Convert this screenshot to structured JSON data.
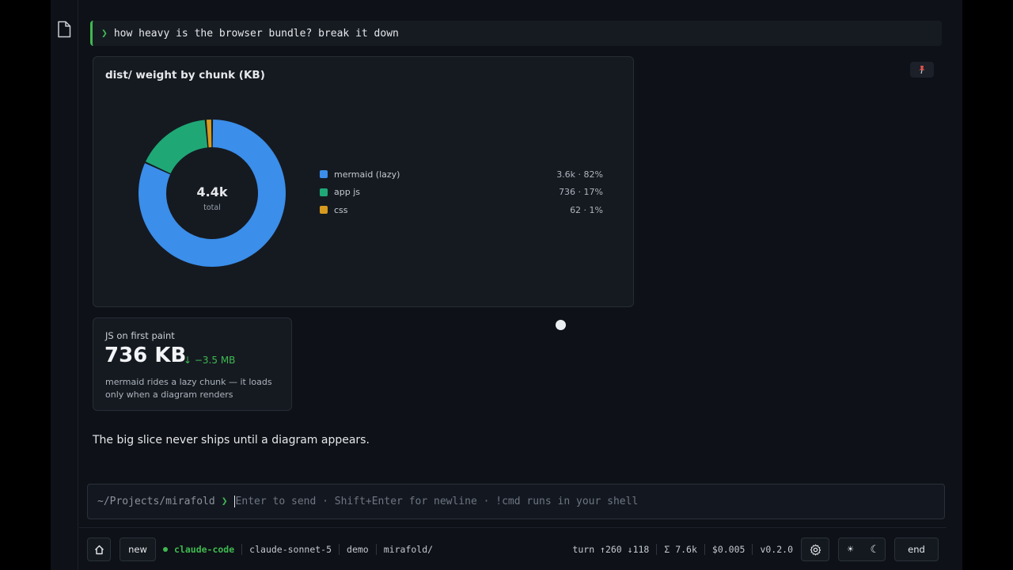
{
  "prompt": {
    "chevron": "❯",
    "text": "how heavy is the browser bundle? break it down"
  },
  "chart_data": {
    "type": "pie",
    "title": "dist/ weight by chunk (KB)",
    "center_value": "4.4k",
    "center_label": "total",
    "categories": [
      "mermaid (lazy)",
      "app js",
      "css"
    ],
    "values": [
      3600,
      736,
      62
    ],
    "value_labels": [
      "3.6k · 82%",
      "736 · 17%",
      "62 · 1%"
    ],
    "colors": [
      "#3b8eea",
      "#1fa876",
      "#d69a1e"
    ],
    "legend": "right"
  },
  "stat": {
    "label": "JS on first paint",
    "value": "736 KB",
    "delta": "↓ −3.5 MB",
    "note": "mermaid rides a lazy chunk — it loads only when a diagram renders",
    "delta_color": "#3fb950"
  },
  "answer": "The big slice never ships until a diagram appears.",
  "input": {
    "path": "~/Projects/mirafold",
    "chevron": "❯",
    "placeholder": "Enter to send · Shift+Enter for newline · !cmd runs in your shell"
  },
  "status": {
    "new_label": "new",
    "agent": "claude-code",
    "model": "claude-sonnet-5",
    "mode": "demo",
    "folder": "mirafold/",
    "turn": "turn ↑260 ↓118",
    "total": "Σ 7.6k",
    "cost": "$0.005",
    "version": "v0.2.0",
    "end_label": "end"
  },
  "icons": {
    "rail": "file-icon",
    "pin": "pin-icon",
    "home": "home-icon",
    "gear": "gear-icon",
    "light": "sun-icon",
    "dark": "moon-icon"
  },
  "colors": {
    "accent": "#3fb950",
    "background": "#0e1117",
    "card": "#151a21"
  }
}
